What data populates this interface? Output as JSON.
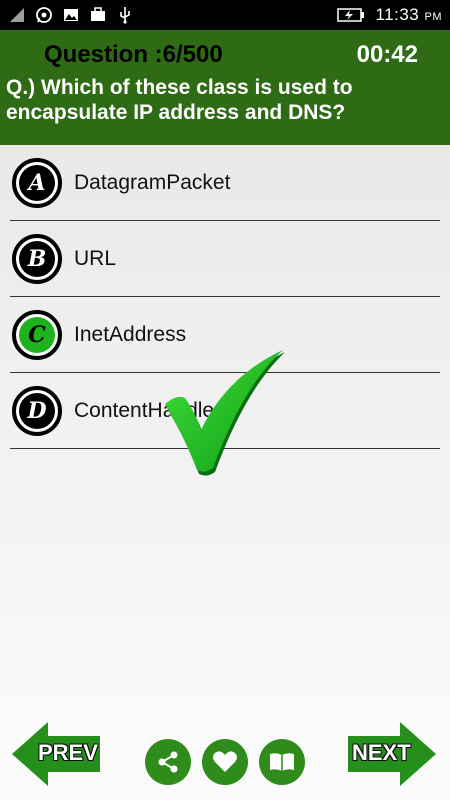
{
  "status_bar": {
    "time": "11:33",
    "ampm": "PM",
    "icons": [
      "signal-icon",
      "whatsapp-icon",
      "image-icon",
      "briefcase-icon",
      "usb-icon",
      "battery-charging-icon"
    ]
  },
  "quiz": {
    "question_counter": "Question :6/500",
    "timer": "00:42",
    "question": "Q.) Which of these class is used to encapsulate IP address and DNS?",
    "options": [
      {
        "letter": "A",
        "text": "DatagramPacket"
      },
      {
        "letter": "B",
        "text": "URL"
      },
      {
        "letter": "C",
        "text": "InetAddress"
      },
      {
        "letter": "D",
        "text": "ContentHandler"
      }
    ],
    "correct_option": "C",
    "feedback_icon": "checkmark-icon"
  },
  "bottom_bar": {
    "prev_label": "PREV",
    "next_label": "NEXT",
    "icons": [
      "share-icon",
      "heart-icon",
      "book-icon"
    ]
  },
  "colors": {
    "header_bg": "#2e6b14",
    "correct": "#1eb21e",
    "action_green": "#2f8b1a"
  }
}
